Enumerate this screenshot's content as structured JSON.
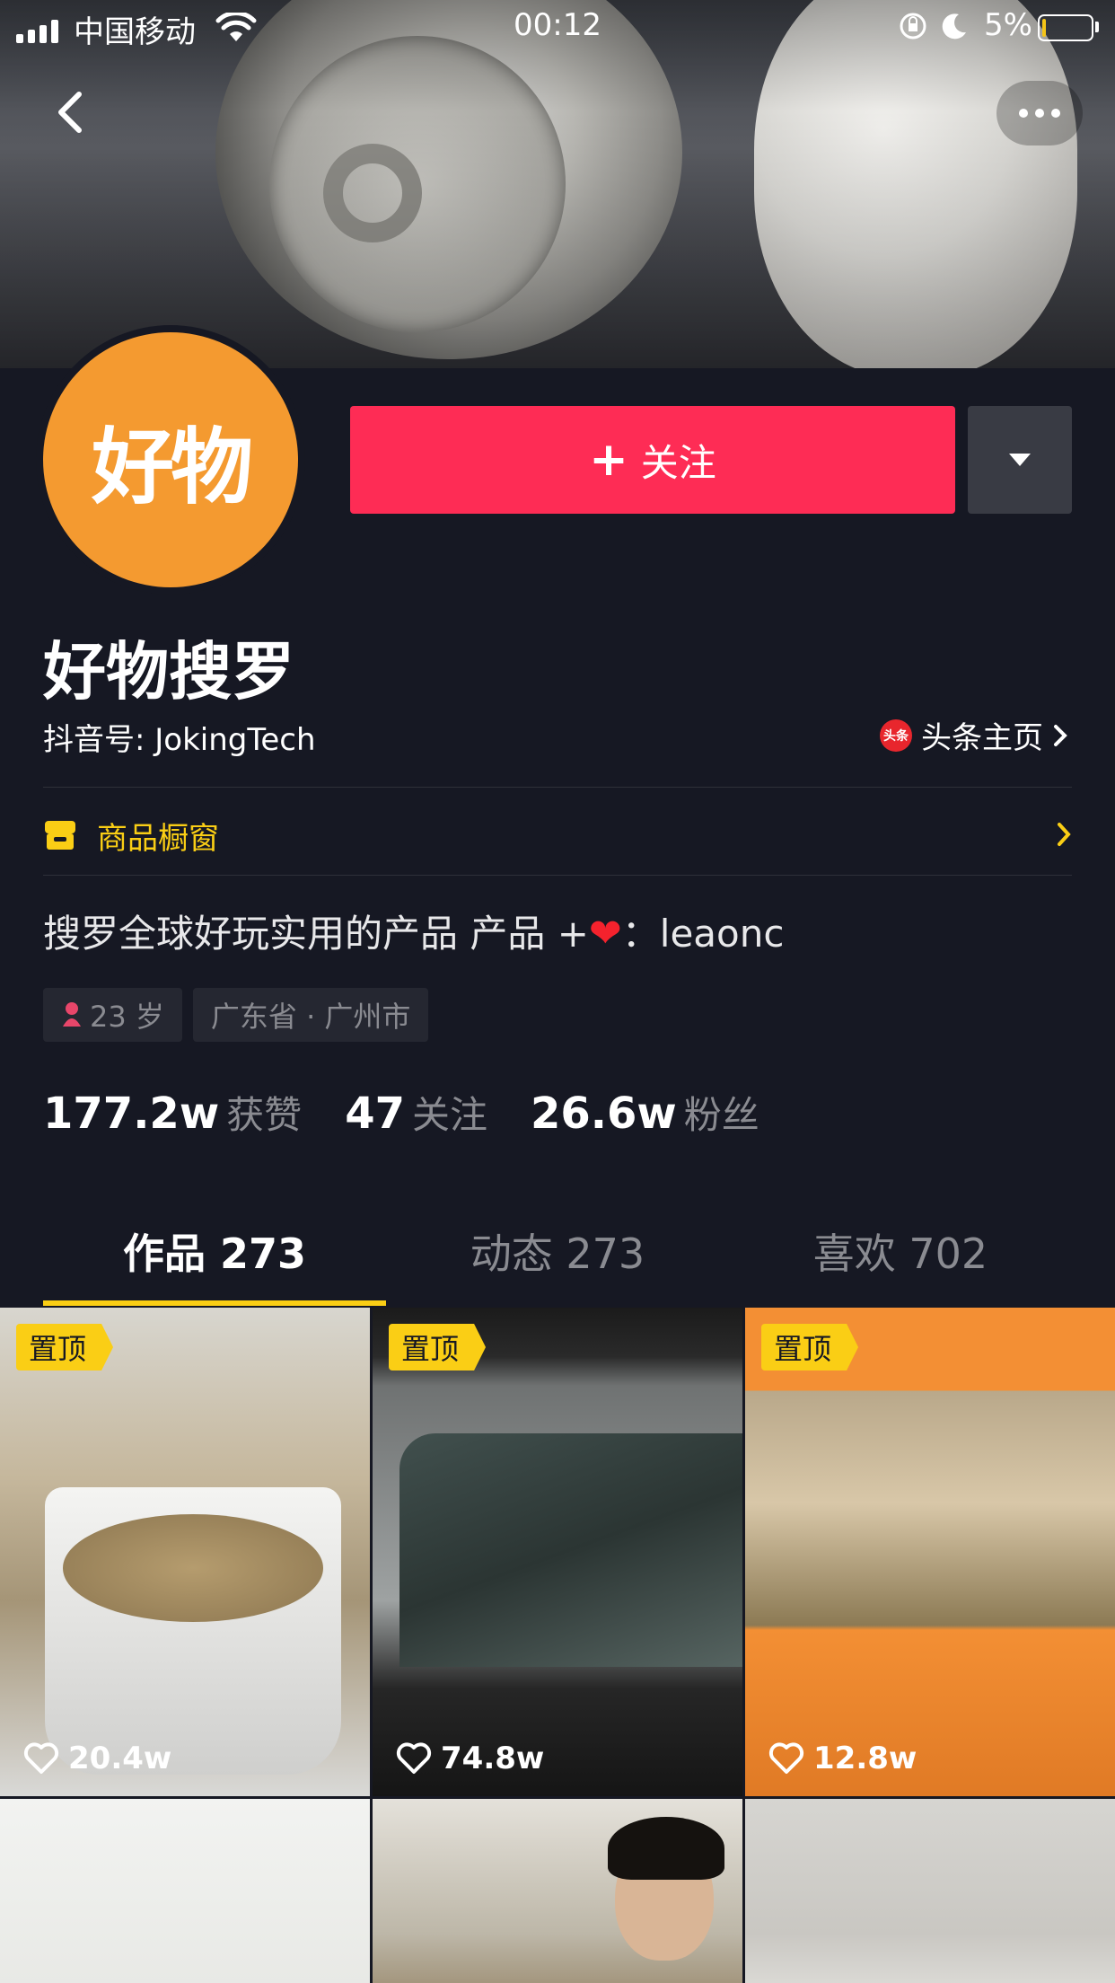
{
  "status_bar": {
    "carrier": "中国移动",
    "time": "00:12",
    "battery": "5%"
  },
  "profile": {
    "avatar_text": "好物",
    "follow_label": "关注",
    "name": "好物搜罗",
    "douyin_id": "抖音号: JokingTech",
    "toutiao_label": "头条主页",
    "toutiao_icon_text": "头条",
    "shop_label": "商品橱窗",
    "bio_prefix": "搜罗全球好玩实用的产品  产品 +",
    "bio_suffix": "：leaonc",
    "tags": {
      "age": "23 岁",
      "location": "广东省 · 广州市"
    },
    "stats": [
      {
        "value": "177.2w",
        "label": "获赞"
      },
      {
        "value": "47",
        "label": "关注"
      },
      {
        "value": "26.6w",
        "label": "粉丝"
      }
    ]
  },
  "tabs": [
    {
      "label": "作品 273",
      "active": true
    },
    {
      "label": "动态 273",
      "active": false
    },
    {
      "label": "喜欢 702",
      "active": false
    }
  ],
  "videos": [
    {
      "pinned": true,
      "pin_label": "置顶",
      "likes": "20.4w"
    },
    {
      "pinned": true,
      "pin_label": "置顶",
      "likes": "74.8w"
    },
    {
      "pinned": true,
      "pin_label": "置顶",
      "likes": "12.8w"
    },
    {
      "pinned": false
    },
    {
      "pinned": false
    },
    {
      "pinned": false
    }
  ],
  "colors": {
    "background": "#161823",
    "follow": "#fe2c55",
    "accent": "#face15",
    "avatar": "#f49a30"
  }
}
